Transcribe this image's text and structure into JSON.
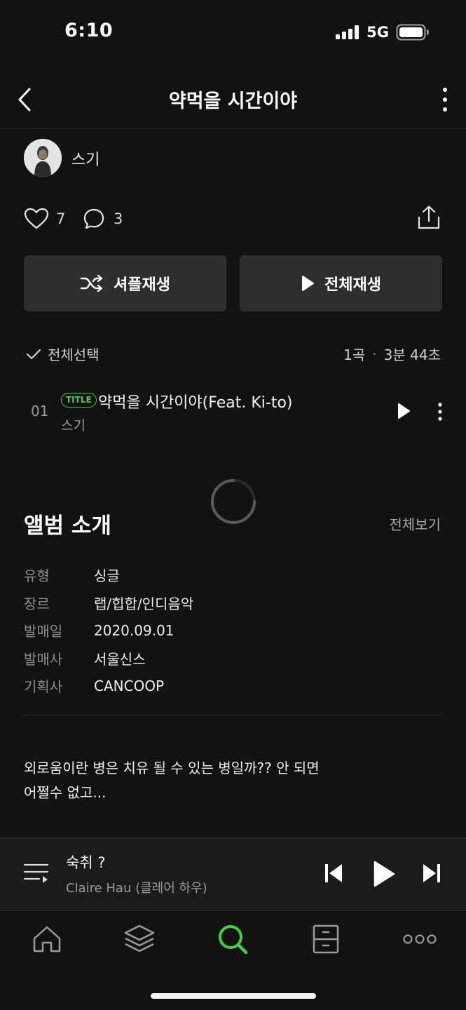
{
  "status_bar": {
    "time": "6:10",
    "network": "5G"
  },
  "header": {
    "title": "약먹을 시간이야"
  },
  "artist": {
    "name": "스기"
  },
  "stats": {
    "likes": "7",
    "comments": "3"
  },
  "actions": {
    "shuffle_label": "셔플재생",
    "play_all_label": "전체재생"
  },
  "track_list": {
    "select_all_label": "전체선택",
    "track_count": "1곡",
    "separator": "·",
    "total_duration": "3분 44초",
    "tracks": [
      {
        "number": "01",
        "badge": "TITLE",
        "title": "약먹을 시간이야(Feat. Ki-to)",
        "artist": "스기"
      }
    ]
  },
  "album_intro": {
    "heading": "앨범 소개",
    "view_all_label": "전체보기",
    "info": [
      {
        "label": "유형",
        "value": "싱글"
      },
      {
        "label": "장르",
        "value": "랩/힙합/인디음악"
      },
      {
        "label": "발매일",
        "value": "2020.09.01"
      },
      {
        "label": "발매사",
        "value": "서울신스"
      },
      {
        "label": "기획사",
        "value": "CANCOOP"
      }
    ],
    "description_line1": "외로움이란 병은 치유 될 수 있는 병일까?? 안 되면",
    "description_line2": "어쩔수 없고..."
  },
  "mini_player": {
    "title": "숙취 ?",
    "artist": "Claire Hau (클레어 하우)"
  },
  "tabs": [
    {
      "name": "home",
      "icon": "home-icon",
      "active": false
    },
    {
      "name": "library-stack",
      "icon": "layers-icon",
      "active": true
    },
    {
      "name": "search",
      "icon": "search-icon",
      "active": true
    },
    {
      "name": "storage",
      "icon": "drawer-icon",
      "active": false
    },
    {
      "name": "more",
      "icon": "more-dots-icon",
      "active": false
    }
  ],
  "colors": {
    "accent": "#3fd13f",
    "background": "#121212",
    "button_bg": "#2e2e2e"
  }
}
